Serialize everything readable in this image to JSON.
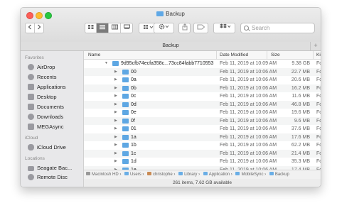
{
  "window": {
    "title": "Backup"
  },
  "toolbar": {
    "back_icon": "chevron-left-icon",
    "forward_icon": "chevron-right-icon",
    "search_placeholder": "Search"
  },
  "tab": {
    "label": "Backup",
    "add": "+"
  },
  "sidebar": {
    "favorites_label": "Favorites",
    "favorites": [
      {
        "label": "AirDrop",
        "icon": "airdrop-icon"
      },
      {
        "label": "Recents",
        "icon": "clock-icon"
      },
      {
        "label": "Applications",
        "icon": "applications-icon"
      },
      {
        "label": "Desktop",
        "icon": "desktop-icon"
      },
      {
        "label": "Documents",
        "icon": "document-icon"
      },
      {
        "label": "Downloads",
        "icon": "download-icon"
      },
      {
        "label": "MEGAsync",
        "icon": "cloud-folder-icon"
      }
    ],
    "icloud_label": "iCloud",
    "icloud": [
      {
        "label": "iCloud Drive",
        "icon": "cloud-icon"
      }
    ],
    "locations_label": "Locations",
    "locations": [
      {
        "label": "Seagate Bac...",
        "icon": "drive-icon"
      },
      {
        "label": "Remote Disc",
        "icon": "disc-icon"
      }
    ]
  },
  "columns": {
    "name": "Name",
    "date": "Date Modified",
    "size": "Size",
    "kind": "Kind"
  },
  "rows": [
    {
      "name": "9d95cfb74ecfa358c...73cc84fabb7710553",
      "date": "Feb 11, 2019 at 10:09 AM",
      "size": "9.38 GB",
      "kind": "Fold"
    },
    {
      "name": "00",
      "date": "Feb 11, 2019 at 10:06 AM",
      "size": "22.7 MB",
      "kind": "Fold"
    },
    {
      "name": "0a",
      "date": "Feb 11, 2019 at 10:06 AM",
      "size": "20.6 MB",
      "kind": "Fold"
    },
    {
      "name": "0b",
      "date": "Feb 11, 2019 at 10:06 AM",
      "size": "16.2 MB",
      "kind": "Fold"
    },
    {
      "name": "0c",
      "date": "Feb 11, 2019 at 10:06 AM",
      "size": "11.6 MB",
      "kind": "Fold"
    },
    {
      "name": "0d",
      "date": "Feb 11, 2019 at 10:06 AM",
      "size": "46.8 MB",
      "kind": "Fold"
    },
    {
      "name": "0e",
      "date": "Feb 11, 2019 at 10:06 AM",
      "size": "19.6 MB",
      "kind": "Fold"
    },
    {
      "name": "0f",
      "date": "Feb 11, 2019 at 10:06 AM",
      "size": "9.6 MB",
      "kind": "Fold"
    },
    {
      "name": "01",
      "date": "Feb 11, 2019 at 10:06 AM",
      "size": "37.6 MB",
      "kind": "Fold"
    },
    {
      "name": "1a",
      "date": "Feb 11, 2019 at 10:06 AM",
      "size": "17.6 MB",
      "kind": "Fold"
    },
    {
      "name": "1b",
      "date": "Feb 11, 2019 at 10:06 AM",
      "size": "62.2 MB",
      "kind": "Fold"
    },
    {
      "name": "1c",
      "date": "Feb 11, 2019 at 10:06 AM",
      "size": "21.4 MB",
      "kind": "Fold"
    },
    {
      "name": "1d",
      "date": "Feb 11, 2019 at 10:06 AM",
      "size": "35.3 MB",
      "kind": "Fold"
    },
    {
      "name": "1e",
      "date": "Feb 11, 2019 at 10:06 AM",
      "size": "17.4 MB",
      "kind": "Fold"
    },
    {
      "name": "1f",
      "date": "Feb 11, 2019 at 10:06 AM",
      "size": "19.7 MB",
      "kind": "Fold"
    }
  ],
  "path": [
    "Macintosh HD",
    "Users",
    "christophe",
    "Library",
    "Application",
    "MobileSync",
    "Backup"
  ],
  "status": "261 items, 7.62 GB available"
}
